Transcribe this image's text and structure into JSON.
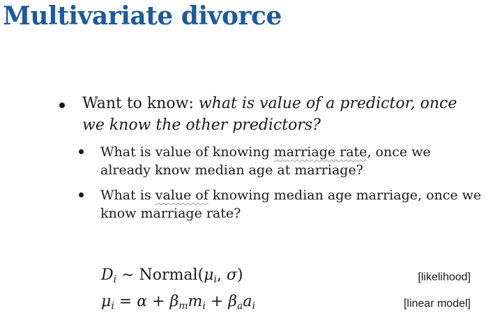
{
  "slide": {
    "title": "Multivariate divorce",
    "bullet1": {
      "lead": "Want to know: ",
      "emphasis": "what is value of a predictor, once we know the other predictors?"
    },
    "sub_bullets": [
      {
        "pre": "What is value of knowing ",
        "squiggle": "marriage rate",
        "post": ", once we already know median age at marriage?"
      },
      {
        "pre": "What is ",
        "squiggle": "value of",
        "post": " knowing median age marriage, once we know marriage rate?"
      }
    ],
    "equations": [
      {
        "lhs_var": "D",
        "lhs_sub": "i",
        "rel": " ∼ ",
        "rhs_pre": "Normal(",
        "mu": "μ",
        "mu_sub": "i",
        "rhs_mid": ", ",
        "sigma": "σ",
        "rhs_post": ")",
        "tag": "[likelihood]"
      },
      {
        "lhs_var": "μ",
        "lhs_sub": "i",
        "rel": " = ",
        "alpha": "α",
        "plus1": " + ",
        "beta_m": "β",
        "beta_m_sub": "m",
        "m": "m",
        "m_sub": "i",
        "plus2": " + ",
        "beta_a": "β",
        "beta_a_sub": "a",
        "a": "a",
        "a_sub": "i",
        "tag": "[linear model]"
      }
    ]
  }
}
